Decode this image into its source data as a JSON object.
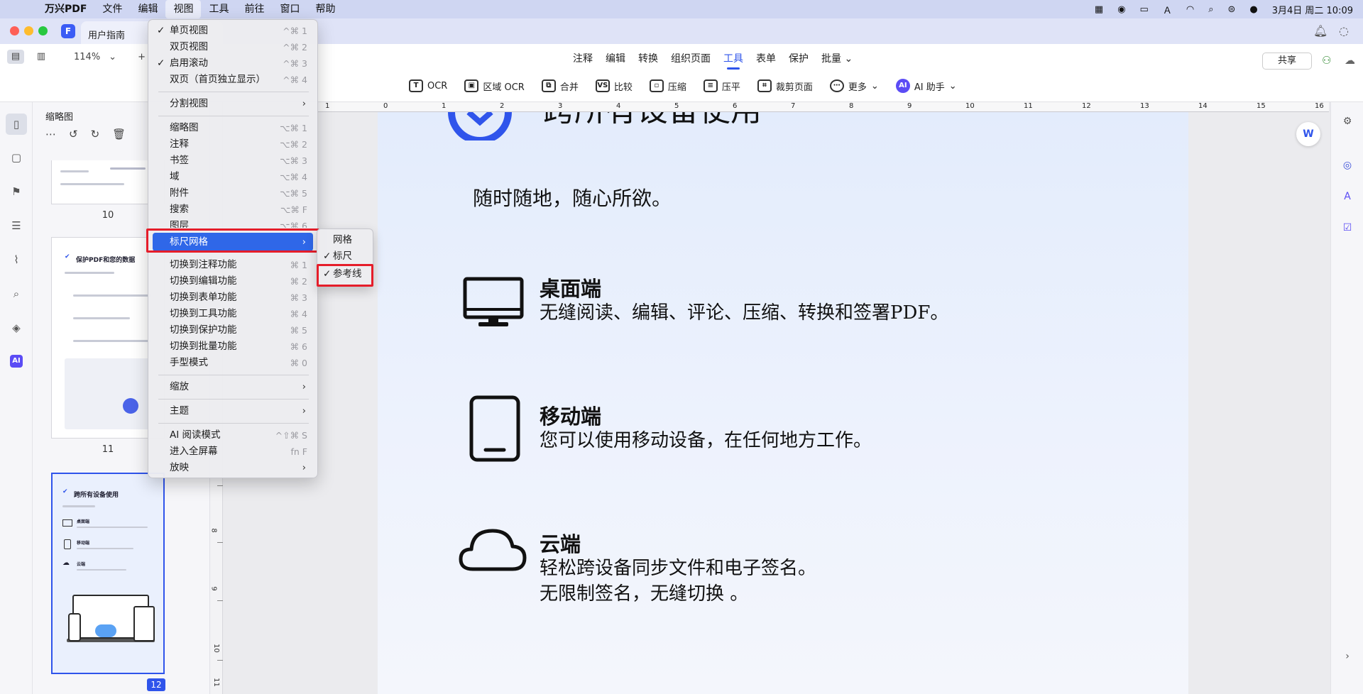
{
  "menubar": {
    "app_name": "万兴PDF",
    "items": [
      "文件",
      "编辑",
      "视图",
      "工具",
      "前往",
      "窗口",
      "帮助"
    ],
    "datetime": "3月4日 周二  10:09"
  },
  "window": {
    "tab_title": "用户指南"
  },
  "toolbar": {
    "zoom": "114%",
    "main_tabs": [
      "注释",
      "编辑",
      "转换",
      "组织页面",
      "工具",
      "表单",
      "保护",
      "批量"
    ],
    "active_tab": "工具",
    "tools": [
      "OCR",
      "区域 OCR",
      "合并",
      "比较",
      "压缩",
      "压平",
      "裁剪页面",
      "更多",
      "AI 助手"
    ],
    "share_label": "共享"
  },
  "thumbnails": {
    "title": "缩略图",
    "pages": [
      "10",
      "11",
      "12"
    ],
    "thumb11_heading": "保护PDF和您的数据",
    "thumb12_heading": "跨所有设备使用",
    "thumb12_items": [
      "桌面端",
      "移动端",
      "云端"
    ]
  },
  "view_menu": {
    "items": [
      {
        "label": "单页视图",
        "check": "✓",
        "shortcut": "^⌘ 1"
      },
      {
        "label": "双页视图",
        "check": "",
        "shortcut": "^⌘ 2"
      },
      {
        "label": "启用滚动",
        "check": "✓",
        "shortcut": "^⌘ 3"
      },
      {
        "label": "双页（首页独立显示）",
        "check": "",
        "shortcut": "^⌘ 4"
      },
      {
        "label": "分割视图",
        "check": "",
        "shortcut": ""
      },
      {
        "label": "缩略图",
        "check": "",
        "shortcut": "⌥⌘ 1"
      },
      {
        "label": "注释",
        "check": "",
        "shortcut": "⌥⌘ 2"
      },
      {
        "label": "书签",
        "check": "",
        "shortcut": "⌥⌘ 3"
      },
      {
        "label": "域",
        "check": "",
        "shortcut": "⌥⌘ 4"
      },
      {
        "label": "附件",
        "check": "",
        "shortcut": "⌥⌘ 5"
      },
      {
        "label": "搜索",
        "check": "",
        "shortcut": "⌥⌘ F"
      },
      {
        "label": "图层",
        "check": "",
        "shortcut": "⌥⌘ 6"
      },
      {
        "label": "标尺网格",
        "check": "",
        "shortcut": ""
      },
      {
        "label": "切换到注释功能",
        "check": "",
        "shortcut": "⌘ 1"
      },
      {
        "label": "切换到编辑功能",
        "check": "",
        "shortcut": "⌘ 2"
      },
      {
        "label": "切换到表单功能",
        "check": "",
        "shortcut": "⌘ 3"
      },
      {
        "label": "切换到工具功能",
        "check": "",
        "shortcut": "⌘ 4"
      },
      {
        "label": "切换到保护功能",
        "check": "",
        "shortcut": "⌘ 5"
      },
      {
        "label": "切换到批量功能",
        "check": "",
        "shortcut": "⌘ 6"
      },
      {
        "label": "手型模式",
        "check": "",
        "shortcut": "⌘ 0"
      },
      {
        "label": "缩放",
        "check": "",
        "shortcut": ""
      },
      {
        "label": "主题",
        "check": "",
        "shortcut": ""
      },
      {
        "label": "AI 阅读模式",
        "check": "",
        "shortcut": "^⇧⌘ S"
      },
      {
        "label": "进入全屏幕",
        "check": "",
        "shortcut": "fn F"
      },
      {
        "label": "放映",
        "check": "",
        "shortcut": ""
      }
    ]
  },
  "ruler_submenu": {
    "items": [
      {
        "label": "网格",
        "check": ""
      },
      {
        "label": "标尺",
        "check": "✓"
      },
      {
        "label": "参考线",
        "check": "✓"
      }
    ]
  },
  "ruler": {
    "h_labels": [
      "1",
      "0",
      "1",
      "2",
      "3",
      "4",
      "5",
      "6",
      "7",
      "8",
      "9",
      "10",
      "11",
      "12",
      "13",
      "14",
      "15",
      "16"
    ],
    "v_labels": [
      "8",
      "9",
      "10",
      "11"
    ]
  },
  "page": {
    "heading": "跨所有设备使用",
    "tagline": "随时随地，随心所欲。",
    "sections": [
      {
        "title": "桌面端",
        "desc": [
          "无缝阅读、编辑、评论、压缩、转换和签署PDF。"
        ]
      },
      {
        "title": "移动端",
        "desc": [
          "您可以使用移动设备，在任何地方工作。"
        ]
      },
      {
        "title": "云端",
        "desc": [
          "轻松跨设备同步文件和电子签名。",
          "无限制签名，无缝切换 。"
        ]
      }
    ]
  },
  "colors": {
    "accent": "#2f54eb",
    "menu_highlight": "#2f67e8",
    "annotation_red": "#e51d2a"
  }
}
